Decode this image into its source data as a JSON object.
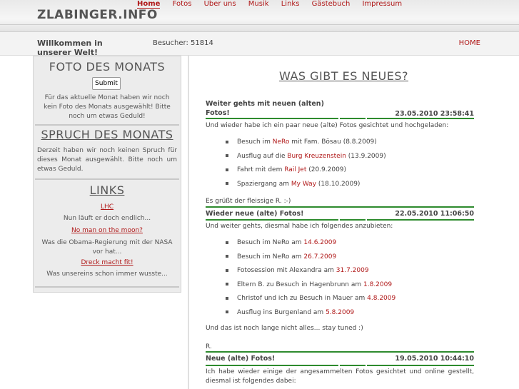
{
  "site": {
    "logo": "ZLABINGER.INFO",
    "nav": [
      "Home",
      "Fotos",
      "Über uns",
      "Musik",
      "Links",
      "Gästebuch",
      "Impressum"
    ],
    "welcome": "Willkommen in unserer Welt!",
    "visitors": "Besucher: 51814",
    "home_link": "HOME"
  },
  "sidebar": {
    "photo_title": "FOTO DES MONATS",
    "submit_label": "Submit",
    "photo_text": "Für das aktuelle Monat haben wir noch kein Foto des Monats ausgewählt! Bitte noch um etwas Geduld!",
    "quote_title": "SPRUCH DES MONATS",
    "quote_text": "Derzeit haben wir noch keinen Spruch für dieses Monat ausgewählt. Bitte noch um etwas Geduld.",
    "links_title": "LINKS",
    "links": [
      {
        "label": "LHC",
        "note": "Nun läuft er doch endlich..."
      },
      {
        "label": "No man on the moon?",
        "note": "Was die Obama-Regierung mit der NASA vor hat..."
      },
      {
        "label": "Dreck macht fit!",
        "note": "Was unsereins schon immer wusste..."
      }
    ]
  },
  "main": {
    "title": "WAS GIBT ES NEUES?",
    "entry1": {
      "title": "Weiter gehts mit neuen (alten) Fotos!",
      "date": "23.05.2010 23:58:41",
      "intro": "Und wieder habe ich ein paar neue (alte) Fotos gesichtet und hochgeladen:",
      "items": [
        {
          "pre": "Besuch im ",
          "link": "NeRo",
          "post": " mit Fam. Bösau (8.8.2009)"
        },
        {
          "pre": "Ausflug auf die ",
          "link": "Burg Kreuzenstein",
          "post": " (13.9.2009)"
        },
        {
          "pre": "Fahrt mit dem ",
          "link": "Rail Jet",
          "post": " (20.9.2009)"
        },
        {
          "pre": "Spaziergang am ",
          "link": "My Way",
          "post": " (18.10.2009)"
        }
      ],
      "signoff": "Es grüßt der fleissige R. :-)"
    },
    "entry2": {
      "title": "Wieder neue (alte) Fotos!",
      "date": "22.05.2010 11:06:50",
      "intro": "Und weiter gehts, diesmal habe ich folgendes anzubieten:",
      "items": [
        {
          "pre": "Besuch im NeRo am ",
          "link": "14.6.2009",
          "post": ""
        },
        {
          "pre": "Besuch im NeRo am ",
          "link": "26.7.2009",
          "post": ""
        },
        {
          "pre": "Fotosession mit Alexandra am ",
          "link": "31.7.2009",
          "post": ""
        },
        {
          "pre": "Eltern B. zu Besuch in Hagenbrunn am ",
          "link": "1.8.2009",
          "post": ""
        },
        {
          "pre": "Christof und ich zu Besuch in Mauer am ",
          "link": "4.8.2009",
          "post": ""
        },
        {
          "pre": "Ausflug ins Burgenland am ",
          "link": "5.8.2009",
          "post": ""
        }
      ],
      "outro": "Und das ist noch lange nicht alles... stay tuned :)",
      "signoff": "R."
    },
    "entry3": {
      "title": "Neue (alte) Fotos!",
      "date": "19.05.2010 10:44:10",
      "intro": "Ich habe wieder einige der angesammelten Fotos gesichtet und online gestellt, diesmal ist folgendes dabei:"
    }
  }
}
